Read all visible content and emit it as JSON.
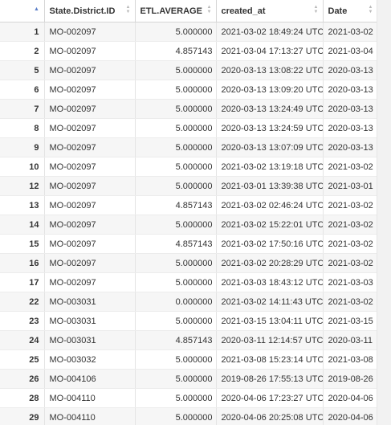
{
  "columns": [
    {
      "label": ""
    },
    {
      "label": "State.District.ID"
    },
    {
      "label": "ETL.AVERAGE"
    },
    {
      "label": "created_at"
    },
    {
      "label": "Date"
    }
  ],
  "rows": [
    {
      "idx": "1",
      "id": "MO-002097",
      "avg": "5.000000",
      "created": "2021-03-02 18:49:24 UTC",
      "date": "2021-03-02"
    },
    {
      "idx": "2",
      "id": "MO-002097",
      "avg": "4.857143",
      "created": "2021-03-04 17:13:27 UTC",
      "date": "2021-03-04"
    },
    {
      "idx": "5",
      "id": "MO-002097",
      "avg": "5.000000",
      "created": "2020-03-13 13:08:22 UTC",
      "date": "2020-03-13"
    },
    {
      "idx": "6",
      "id": "MO-002097",
      "avg": "5.000000",
      "created": "2020-03-13 13:09:20 UTC",
      "date": "2020-03-13"
    },
    {
      "idx": "7",
      "id": "MO-002097",
      "avg": "5.000000",
      "created": "2020-03-13 13:24:49 UTC",
      "date": "2020-03-13"
    },
    {
      "idx": "8",
      "id": "MO-002097",
      "avg": "5.000000",
      "created": "2020-03-13 13:24:59 UTC",
      "date": "2020-03-13"
    },
    {
      "idx": "9",
      "id": "MO-002097",
      "avg": "5.000000",
      "created": "2020-03-13 13:07:09 UTC",
      "date": "2020-03-13"
    },
    {
      "idx": "10",
      "id": "MO-002097",
      "avg": "5.000000",
      "created": "2021-03-02 13:19:18 UTC",
      "date": "2021-03-02"
    },
    {
      "idx": "12",
      "id": "MO-002097",
      "avg": "5.000000",
      "created": "2021-03-01 13:39:38 UTC",
      "date": "2021-03-01"
    },
    {
      "idx": "13",
      "id": "MO-002097",
      "avg": "4.857143",
      "created": "2021-03-02 02:46:24 UTC",
      "date": "2021-03-02"
    },
    {
      "idx": "14",
      "id": "MO-002097",
      "avg": "5.000000",
      "created": "2021-03-02 15:22:01 UTC",
      "date": "2021-03-02"
    },
    {
      "idx": "15",
      "id": "MO-002097",
      "avg": "4.857143",
      "created": "2021-03-02 17:50:16 UTC",
      "date": "2021-03-02"
    },
    {
      "idx": "16",
      "id": "MO-002097",
      "avg": "5.000000",
      "created": "2021-03-02 20:28:29 UTC",
      "date": "2021-03-02"
    },
    {
      "idx": "17",
      "id": "MO-002097",
      "avg": "5.000000",
      "created": "2021-03-03 18:43:12 UTC",
      "date": "2021-03-03"
    },
    {
      "idx": "22",
      "id": "MO-003031",
      "avg": "0.000000",
      "created": "2021-03-02 14:11:43 UTC",
      "date": "2021-03-02"
    },
    {
      "idx": "23",
      "id": "MO-003031",
      "avg": "5.000000",
      "created": "2021-03-15 13:04:11 UTC",
      "date": "2021-03-15"
    },
    {
      "idx": "24",
      "id": "MO-003031",
      "avg": "4.857143",
      "created": "2020-03-11 12:14:57 UTC",
      "date": "2020-03-11"
    },
    {
      "idx": "25",
      "id": "MO-003032",
      "avg": "5.000000",
      "created": "2021-03-08 15:23:14 UTC",
      "date": "2021-03-08"
    },
    {
      "idx": "26",
      "id": "MO-004106",
      "avg": "5.000000",
      "created": "2019-08-26 17:55:13 UTC",
      "date": "2019-08-26"
    },
    {
      "idx": "28",
      "id": "MO-004110",
      "avg": "5.000000",
      "created": "2020-04-06 17:23:27 UTC",
      "date": "2020-04-06"
    },
    {
      "idx": "29",
      "id": "MO-004110",
      "avg": "5.000000",
      "created": "2020-04-06 20:25:08 UTC",
      "date": "2020-04-06"
    }
  ],
  "icons": {
    "sort": "sort-icon",
    "sort_asc": "sort-ascending-icon"
  },
  "colors": {
    "zebra": "#f6f6f6",
    "accent": "#5b7ec8",
    "border": "#d6d6d6"
  }
}
